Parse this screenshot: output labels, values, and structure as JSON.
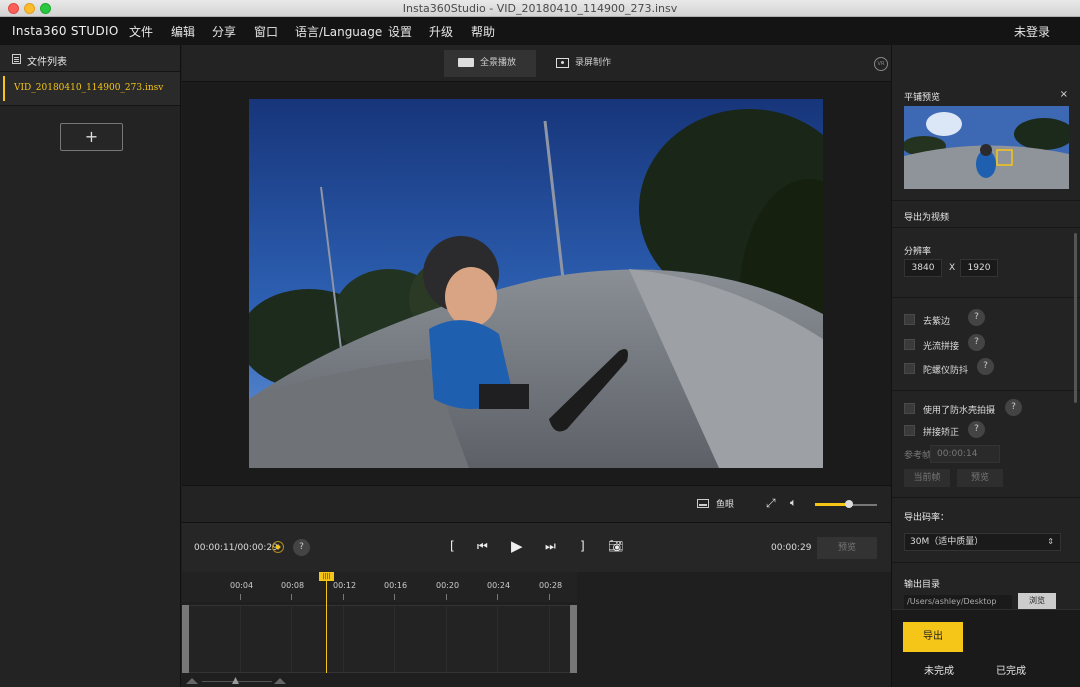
{
  "window": {
    "title": "Insta360Studio - VID_20180410_114900_273.insv"
  },
  "menubar": {
    "brand": "Insta360 STUDIO",
    "items": [
      "文件",
      "编辑",
      "分享",
      "窗口",
      "语言/Language",
      "设置",
      "升级",
      "帮助"
    ],
    "login": "未登录"
  },
  "sidebar": {
    "title": "文件列表",
    "files": [
      "VID_20180410_114900_273.insv"
    ],
    "add_label": "+"
  },
  "view_tabs": {
    "panorama": "全景播放",
    "record": "录屏制作",
    "vr_icon_text": "VR"
  },
  "video_controls": {
    "fisheye": "鱼眼",
    "volume": 0.55
  },
  "playback": {
    "current": "00:00:11/00:00:29",
    "total": "00:00:29",
    "help": "?",
    "preview": "预览",
    "mark_in": "[",
    "mark_out": "]"
  },
  "timeline": {
    "ticks": [
      "00:04",
      "00:08",
      "00:12",
      "00:16",
      "00:20",
      "00:24",
      "00:28"
    ],
    "playhead_label": "||||"
  },
  "right_panel": {
    "preview_title": "平铺预览",
    "close": "×",
    "export_video_title": "导出为视频",
    "resolution_label": "分辨率",
    "res_w": "3840",
    "res_x": "X",
    "res_h": "1920",
    "options": [
      {
        "label": "去紫边",
        "help": "?"
      },
      {
        "label": "光流拼接",
        "help": "?"
      },
      {
        "label": "陀螺仪防抖",
        "help": "?"
      },
      {
        "label": "使用了防水壳拍摄",
        "help": "?"
      },
      {
        "label": "拼接矫正",
        "help": "?"
      }
    ],
    "ref_label": "参考帧",
    "ref_value": "00:00:14",
    "current_frame": "当前帧",
    "preview_btn": "预览",
    "bitrate_label": "导出码率：",
    "bitrate_value": "30M（适中质量）",
    "bitrate_arrow": "⇕",
    "output_label": "输出目录",
    "output_path": "/Users/ashley/Desktop",
    "browse": "浏览",
    "export": "导出",
    "tab_incomplete": "未完成",
    "tab_complete": "已完成"
  }
}
